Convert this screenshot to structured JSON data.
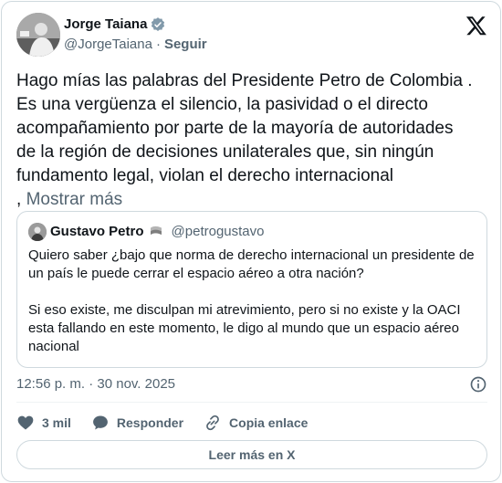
{
  "author": {
    "display_name": "Jorge Taiana",
    "handle": "@JorgeTaiana",
    "separator": "·",
    "follow_label": "Seguir",
    "verified": true
  },
  "tweet": {
    "text": "Hago mías las palabras del Presidente Petro de Colombia .\nEs una vergüenza el silencio, la pasividad o el directo\nacompañamiento por parte de la mayoría de autoridades\nde la región de decisiones unilaterales que, sin ningún\nfundamento legal, violan el derecho internacional\n, ",
    "show_more": "Mostrar más"
  },
  "quote": {
    "display_name": "Gustavo Petro",
    "handle": "@petrogustavo",
    "text": "Quiero saber ¿bajo que norma de derecho internacional un presidente de\nun país le puede cerrar el espacio aéreo a otra nación?\n\nSi eso existe, me disculpan mi atrevimiento, pero si no existe y la OACI\nesta fallando en este momento, le digo al mundo que un espacio aéreo\nnacional"
  },
  "meta": {
    "timestamp": "12:56 p. m. · 30 nov. 2025"
  },
  "actions": {
    "likes": "3 mil",
    "reply_label": "Responder",
    "copy_link_label": "Copia enlace"
  },
  "read_more_label": "Leer más en X",
  "colors": {
    "text": "#0f1419",
    "muted": "#536471",
    "border": "#cfd9de"
  }
}
